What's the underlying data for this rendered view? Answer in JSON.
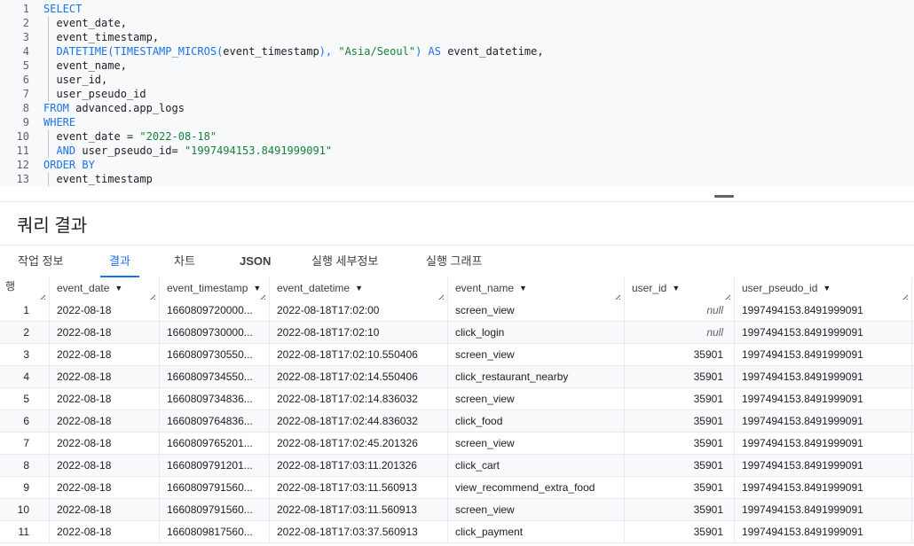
{
  "editor": {
    "lines": [
      {
        "n": "1",
        "indent": false,
        "tokens": [
          {
            "t": "kw",
            "v": "SELECT"
          }
        ]
      },
      {
        "n": "2",
        "indent": true,
        "tokens": [
          {
            "t": "plain",
            "v": "  event_date,"
          }
        ]
      },
      {
        "n": "3",
        "indent": true,
        "tokens": [
          {
            "t": "plain",
            "v": "  event_timestamp,"
          }
        ]
      },
      {
        "n": "4",
        "indent": true,
        "tokens": [
          {
            "t": "kw",
            "v": "  DATETIME(TIMESTAMP_MICROS("
          },
          {
            "t": "plain",
            "v": "event_timestamp"
          },
          {
            "t": "kw",
            "v": "), "
          },
          {
            "t": "str",
            "v": "\"Asia/Seoul\""
          },
          {
            "t": "kw",
            "v": ") AS "
          },
          {
            "t": "plain",
            "v": "event_datetime,"
          }
        ]
      },
      {
        "n": "5",
        "indent": true,
        "tokens": [
          {
            "t": "plain",
            "v": "  event_name,"
          }
        ]
      },
      {
        "n": "6",
        "indent": true,
        "tokens": [
          {
            "t": "plain",
            "v": "  user_id,"
          }
        ]
      },
      {
        "n": "7",
        "indent": true,
        "tokens": [
          {
            "t": "plain",
            "v": "  user_pseudo_id"
          }
        ]
      },
      {
        "n": "8",
        "indent": false,
        "tokens": [
          {
            "t": "kw",
            "v": "FROM "
          },
          {
            "t": "plain",
            "v": "advanced.app_logs"
          }
        ]
      },
      {
        "n": "9",
        "indent": false,
        "tokens": [
          {
            "t": "kw",
            "v": "WHERE"
          }
        ]
      },
      {
        "n": "10",
        "indent": true,
        "tokens": [
          {
            "t": "plain",
            "v": "  event_date = "
          },
          {
            "t": "str",
            "v": "\"2022-08-18\""
          }
        ]
      },
      {
        "n": "11",
        "indent": true,
        "tokens": [
          {
            "t": "kw",
            "v": "  AND "
          },
          {
            "t": "plain",
            "v": "user_pseudo_id= "
          },
          {
            "t": "str",
            "v": "\"1997494153.8491999091\""
          }
        ]
      },
      {
        "n": "12",
        "indent": false,
        "tokens": [
          {
            "t": "kw",
            "v": "ORDER BY"
          }
        ]
      },
      {
        "n": "13",
        "indent": true,
        "tokens": [
          {
            "t": "plain",
            "v": "  event_timestamp"
          }
        ]
      }
    ]
  },
  "results": {
    "title": "쿼리 결과",
    "tabs": [
      {
        "label": "작업 정보",
        "active": false,
        "bold": false
      },
      {
        "label": "결과",
        "active": true,
        "bold": false
      },
      {
        "label": "차트",
        "active": false,
        "bold": false
      },
      {
        "label": "JSON",
        "active": false,
        "bold": true
      },
      {
        "label": "실행 세부정보",
        "active": false,
        "bold": false
      },
      {
        "label": "실행 그래프",
        "active": false,
        "bold": false
      }
    ],
    "row_header": "행",
    "columns": [
      {
        "key": "event_date",
        "label": "event_date",
        "align": "left"
      },
      {
        "key": "event_timestamp",
        "label": "event_timestamp",
        "align": "left"
      },
      {
        "key": "event_datetime",
        "label": "event_datetime",
        "align": "left"
      },
      {
        "key": "event_name",
        "label": "event_name",
        "align": "left"
      },
      {
        "key": "user_id",
        "label": "user_id",
        "align": "right"
      },
      {
        "key": "user_pseudo_id",
        "label": "user_pseudo_id",
        "align": "left"
      }
    ],
    "rows": [
      {
        "n": "1",
        "event_date": "2022-08-18",
        "event_timestamp": "1660809720000...",
        "event_datetime": "2022-08-18T17:02:00",
        "event_name": "screen_view",
        "user_id": "null",
        "user_pseudo_id": "1997494153.8491999091"
      },
      {
        "n": "2",
        "event_date": "2022-08-18",
        "event_timestamp": "1660809730000...",
        "event_datetime": "2022-08-18T17:02:10",
        "event_name": "click_login",
        "user_id": "null",
        "user_pseudo_id": "1997494153.8491999091"
      },
      {
        "n": "3",
        "event_date": "2022-08-18",
        "event_timestamp": "1660809730550...",
        "event_datetime": "2022-08-18T17:02:10.550406",
        "event_name": "screen_view",
        "user_id": "35901",
        "user_pseudo_id": "1997494153.8491999091"
      },
      {
        "n": "4",
        "event_date": "2022-08-18",
        "event_timestamp": "1660809734550...",
        "event_datetime": "2022-08-18T17:02:14.550406",
        "event_name": "click_restaurant_nearby",
        "user_id": "35901",
        "user_pseudo_id": "1997494153.8491999091"
      },
      {
        "n": "5",
        "event_date": "2022-08-18",
        "event_timestamp": "1660809734836...",
        "event_datetime": "2022-08-18T17:02:14.836032",
        "event_name": "screen_view",
        "user_id": "35901",
        "user_pseudo_id": "1997494153.8491999091"
      },
      {
        "n": "6",
        "event_date": "2022-08-18",
        "event_timestamp": "1660809764836...",
        "event_datetime": "2022-08-18T17:02:44.836032",
        "event_name": "click_food",
        "user_id": "35901",
        "user_pseudo_id": "1997494153.8491999091"
      },
      {
        "n": "7",
        "event_date": "2022-08-18",
        "event_timestamp": "1660809765201...",
        "event_datetime": "2022-08-18T17:02:45.201326",
        "event_name": "screen_view",
        "user_id": "35901",
        "user_pseudo_id": "1997494153.8491999091"
      },
      {
        "n": "8",
        "event_date": "2022-08-18",
        "event_timestamp": "1660809791201...",
        "event_datetime": "2022-08-18T17:03:11.201326",
        "event_name": "click_cart",
        "user_id": "35901",
        "user_pseudo_id": "1997494153.8491999091"
      },
      {
        "n": "9",
        "event_date": "2022-08-18",
        "event_timestamp": "1660809791560...",
        "event_datetime": "2022-08-18T17:03:11.560913",
        "event_name": "view_recommend_extra_food",
        "user_id": "35901",
        "user_pseudo_id": "1997494153.8491999091"
      },
      {
        "n": "10",
        "event_date": "2022-08-18",
        "event_timestamp": "1660809791560...",
        "event_datetime": "2022-08-18T17:03:11.560913",
        "event_name": "screen_view",
        "user_id": "35901",
        "user_pseudo_id": "1997494153.8491999091"
      },
      {
        "n": "11",
        "event_date": "2022-08-18",
        "event_timestamp": "1660809817560...",
        "event_datetime": "2022-08-18T17:03:37.560913",
        "event_name": "click_payment",
        "user_id": "35901",
        "user_pseudo_id": "1997494153.8491999091"
      }
    ]
  },
  "colors": {
    "keyword": "#1a73e8",
    "string": "#188038",
    "accent": "#1a73e8"
  },
  "icons": [
    "sort-caret-icon",
    "column-resize-icon",
    "drag-handle-icon"
  ]
}
